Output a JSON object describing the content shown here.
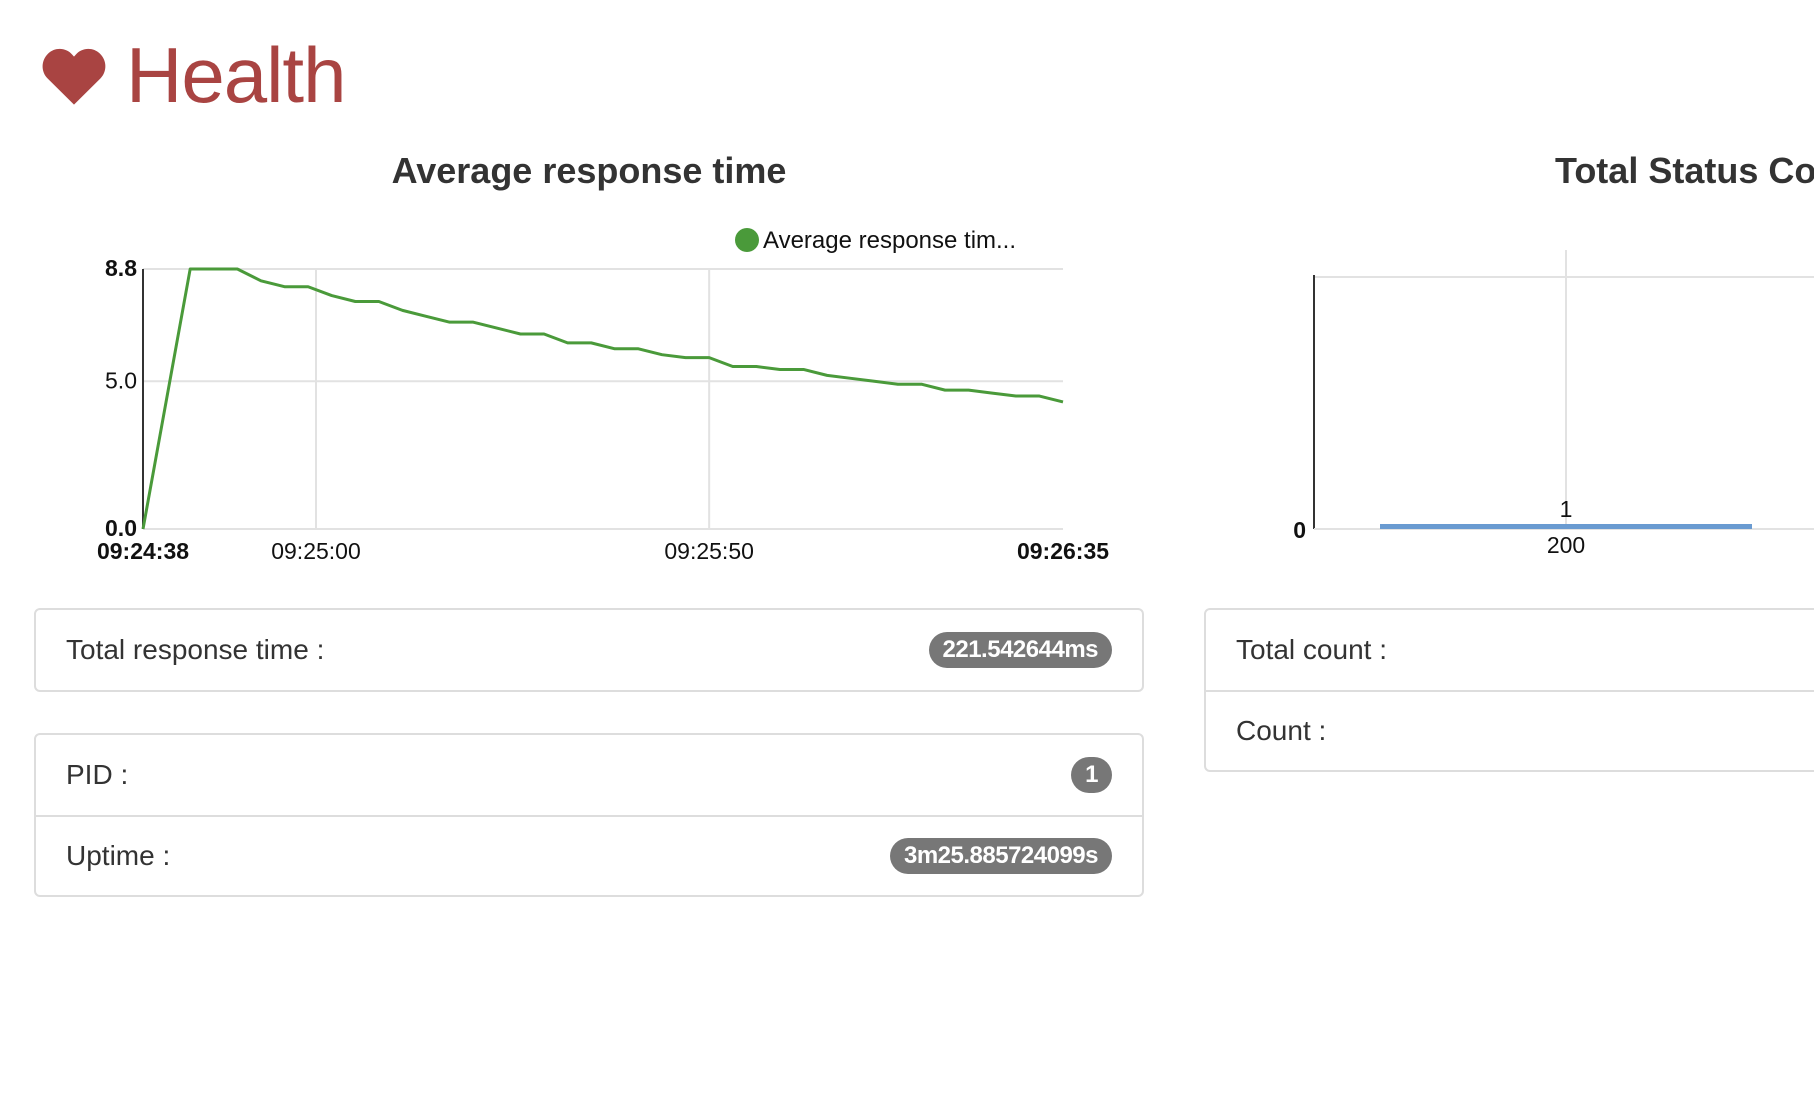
{
  "header": {
    "title": "Health",
    "icon": "heart-icon",
    "accent_color": "#a94442"
  },
  "response_chart": {
    "title": "Average response time",
    "legend": "Average response tim...",
    "line_color": "#4a9a3a",
    "y_ticks": [
      "8.8",
      "5.0",
      "0.0"
    ],
    "x_ticks": [
      "09:24:38",
      "09:25:00",
      "09:25:50",
      "09:26:35"
    ]
  },
  "status_chart": {
    "title": "Total Status Co",
    "bar_color": "#6a9bd1",
    "y_tick": "0",
    "bar_value_label": "1",
    "category_label": "200"
  },
  "total_response_panel": {
    "label": "Total response time :",
    "value": "221.542644ms"
  },
  "process_panel": {
    "pid_label": "PID :",
    "pid_value": "1",
    "uptime_label": "Uptime :",
    "uptime_value": "3m25.885724099s"
  },
  "status_panel": {
    "total_count_label": "Total count :",
    "count_label": "Count :"
  },
  "chart_data": [
    {
      "type": "line",
      "title": "Average response time",
      "xlabel": "",
      "ylabel": "",
      "x": [
        "09:24:38",
        "09:24:44",
        "09:24:50",
        "09:24:53",
        "09:24:56",
        "09:24:59",
        "09:25:02",
        "09:25:05",
        "09:25:08",
        "09:25:11",
        "09:25:14",
        "09:25:17",
        "09:25:20",
        "09:25:23",
        "09:25:26",
        "09:25:29",
        "09:25:32",
        "09:25:35",
        "09:25:38",
        "09:25:41",
        "09:25:44",
        "09:25:47",
        "09:25:50",
        "09:25:53",
        "09:25:56",
        "09:25:59",
        "09:26:02",
        "09:26:05",
        "09:26:08",
        "09:26:11",
        "09:26:14",
        "09:26:17",
        "09:26:20",
        "09:26:23",
        "09:26:26",
        "09:26:29",
        "09:26:32",
        "09:26:35"
      ],
      "series": [
        {
          "name": "Average response tim...",
          "values": [
            0.0,
            8.8,
            8.8,
            8.4,
            8.2,
            8.2,
            7.9,
            7.7,
            7.7,
            7.4,
            7.2,
            7.0,
            7.0,
            6.8,
            6.6,
            6.6,
            6.3,
            6.3,
            6.1,
            6.1,
            5.9,
            5.8,
            5.8,
            5.5,
            5.5,
            5.4,
            5.4,
            5.2,
            5.1,
            5.0,
            4.9,
            4.9,
            4.7,
            4.7,
            4.6,
            4.5,
            4.5,
            4.3
          ]
        }
      ],
      "ylim": [
        0,
        8.8
      ],
      "x_ticks": [
        "09:24:38",
        "09:25:00",
        "09:25:50",
        "09:26:35"
      ],
      "grid": true,
      "legend": "top"
    },
    {
      "type": "bar",
      "title": "Total Status Co",
      "categories": [
        "200"
      ],
      "values": [
        1
      ],
      "grid": true
    }
  ]
}
